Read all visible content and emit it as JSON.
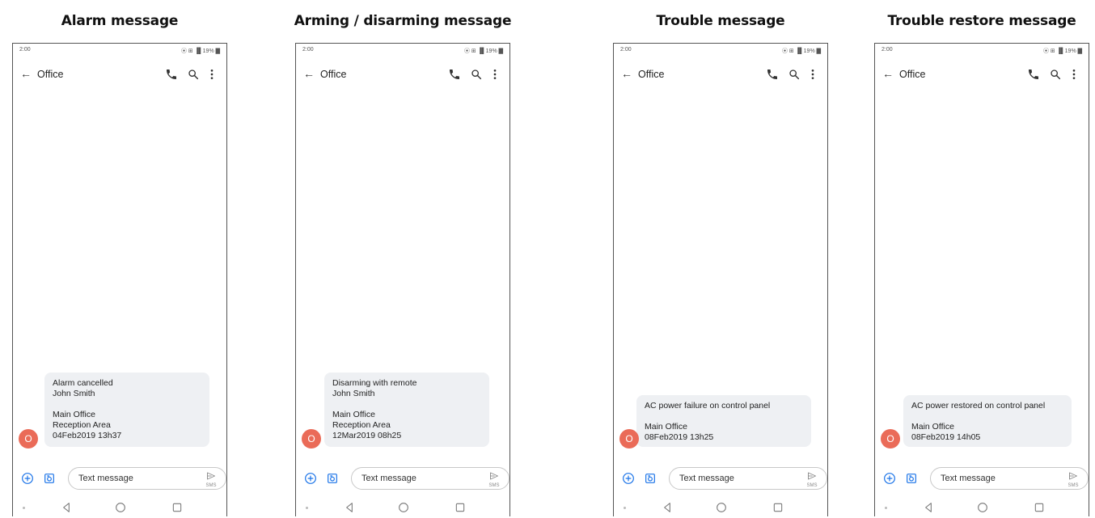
{
  "phone": {
    "status_time": "2:00",
    "status_icons": "⦿ ⊞ ▐▌19% ▇",
    "contact": "Office",
    "avatar_initial": "O",
    "compose_placeholder": "Text message",
    "send_label": "SMS"
  },
  "panels": [
    {
      "title": "Alarm message",
      "lines": [
        "Alarm cancelled",
        "John Smith",
        "",
        "Main Office",
        "Reception Area",
        "04Feb2019 13h37"
      ]
    },
    {
      "title": "Arming / disarming message",
      "lines": [
        "Disarming with remote",
        "John Smith",
        "",
        "Main Office",
        "Reception Area",
        "12Mar2019 08h25"
      ]
    },
    {
      "title": "Trouble message",
      "lines": [
        "AC power failure on control panel",
        "",
        "Main Office",
        "08Feb2019 13h25"
      ]
    },
    {
      "title": "Trouble restore message",
      "lines": [
        "AC power restored on control panel",
        "",
        "Main Office",
        "08Feb2019 14h05"
      ]
    }
  ]
}
